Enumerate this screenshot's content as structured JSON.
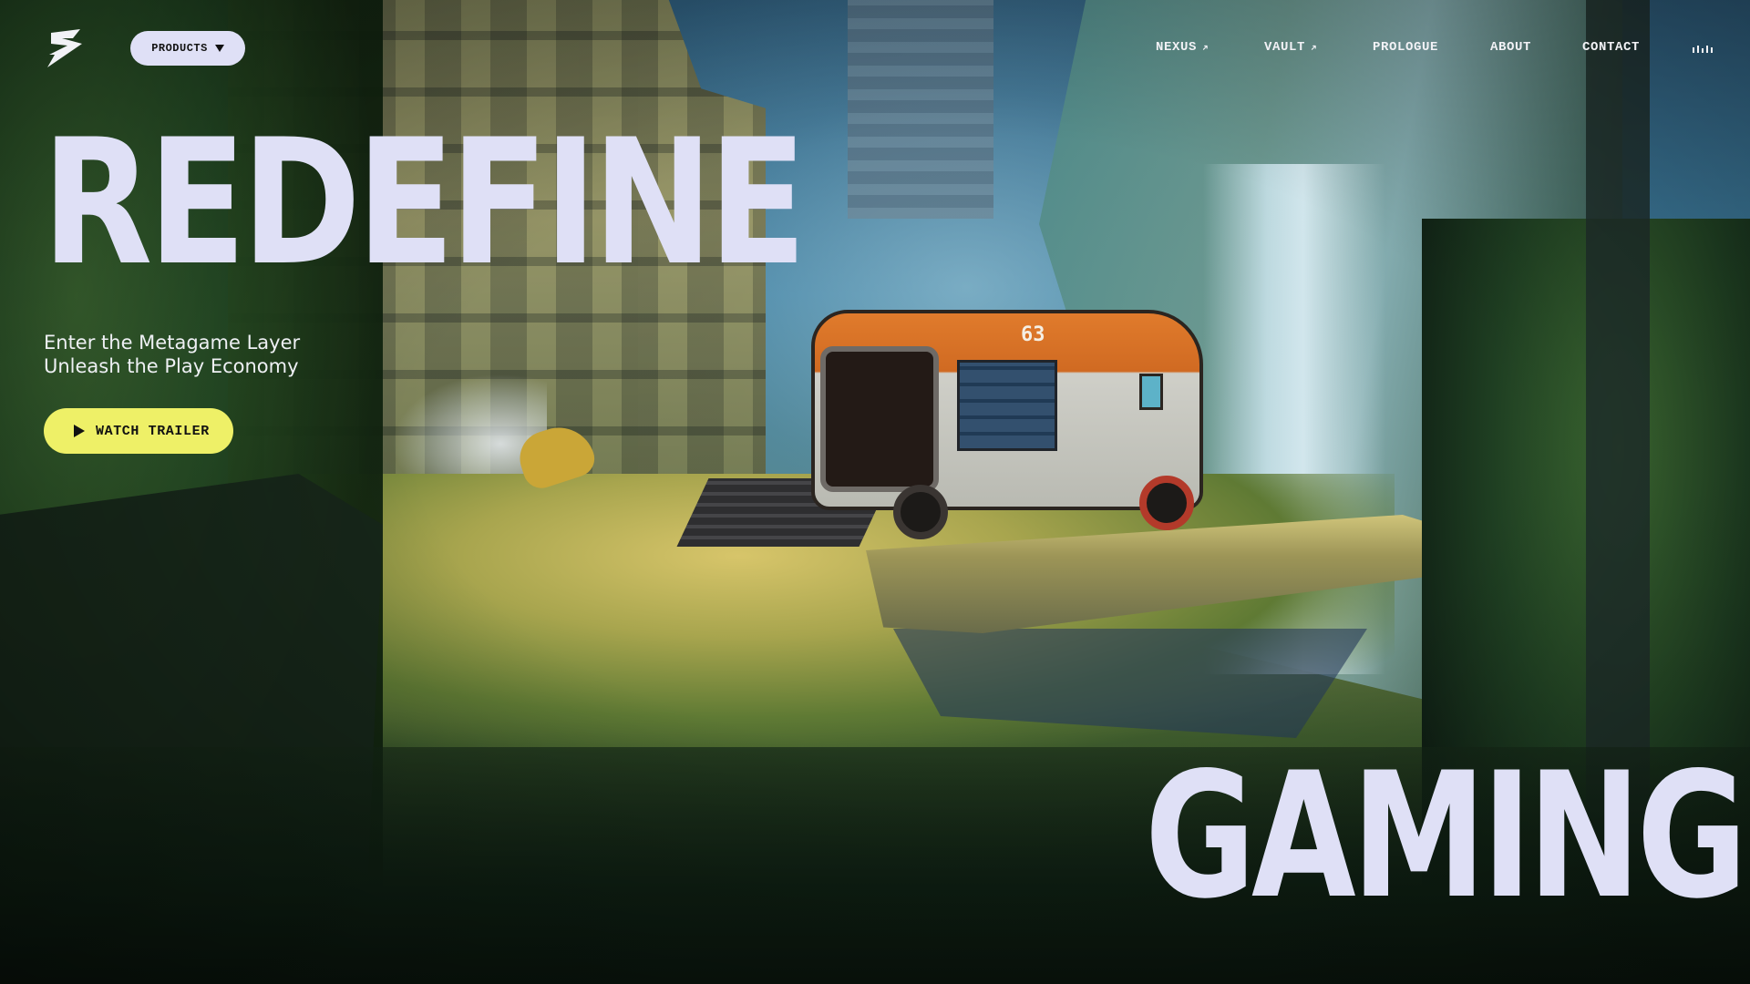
{
  "header": {
    "logo_icon": "z-logo-icon",
    "products": {
      "label": "PRODUCTS",
      "icon": "caret-down-icon"
    }
  },
  "nav": {
    "items": [
      {
        "label": "NEXUS",
        "icon": "arrow-up-right-icon"
      },
      {
        "label": "VAULT",
        "icon": "arrow-up-right-icon"
      },
      {
        "label": "PROLOGUE"
      },
      {
        "label": "ABOUT"
      },
      {
        "label": "CONTACT"
      }
    ],
    "audio_icon": "audio-bars-icon"
  },
  "hero": {
    "headline_top": "REDEFINE",
    "headline_bottom": "GAMING",
    "subtitle_line1": "Enter the Metagame Layer",
    "subtitle_line2": "Unleash the Play Economy",
    "cta": {
      "label": "WATCH TRAILER",
      "icon": "play-icon"
    },
    "vehicle_number": "63"
  },
  "colors": {
    "headline": "#dfe0f6",
    "cta_bg": "#eef067",
    "pill_bg": "#dfe0f6",
    "nav_text": "#f2f2f6"
  }
}
